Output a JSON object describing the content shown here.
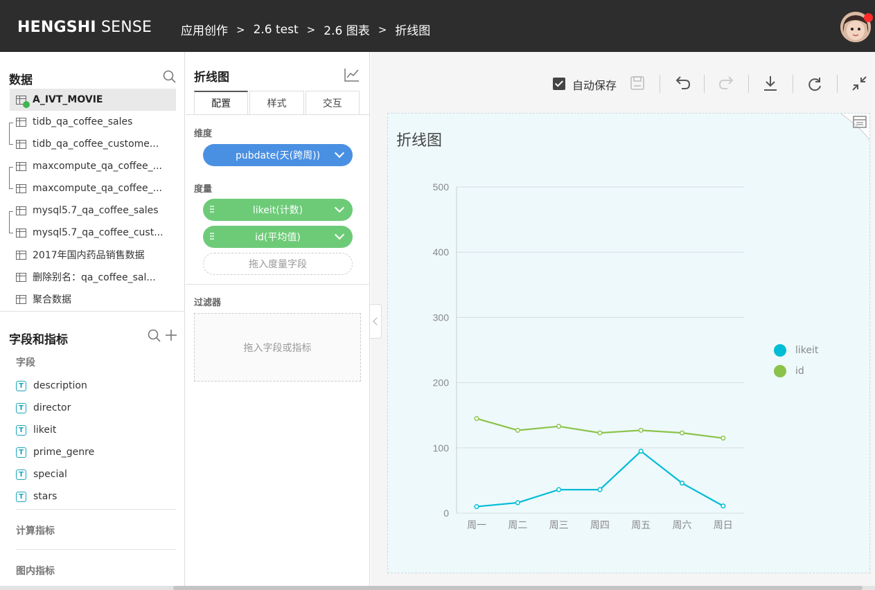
{
  "header": {
    "logo_bold": "HENGSHI",
    "logo_thin": " SENSE",
    "breadcrumbs": [
      "应用创作",
      "2.6 test",
      "2.6 图表",
      "折线图"
    ],
    "separator": ">"
  },
  "data_panel": {
    "title": "数据",
    "datasets": [
      "A_IVT_MOVIE",
      "tidb_qa_coffee_sales",
      "tidb_qa_coffee_custome...",
      "maxcompute_qa_coffee_...",
      "maxcompute_qa_coffee_...",
      "mysql5.7_qa_coffee_sales",
      "mysql5.7_qa_coffee_cust...",
      "2017年国内药品销售数据",
      "删除别名：qa_coffee_sal...",
      "聚合数据"
    ]
  },
  "fields_panel": {
    "title": "字段和指标",
    "fields_label": "字段",
    "fields": [
      "description",
      "director",
      "likeit",
      "prime_genre",
      "special",
      "stars"
    ],
    "calc_label": "计算指标",
    "chart_metric_label": "图内指标",
    "field_type_glyph": "T"
  },
  "config_panel": {
    "title": "折线图",
    "tabs": [
      "配置",
      "样式",
      "交互"
    ],
    "dimension_label": "维度",
    "dimension": "pubdate(天(跨周))",
    "measure_label": "度量",
    "measures": [
      "likeit(计数)",
      "id(平均值)"
    ],
    "measure_drop": "拖入度量字段",
    "filter_label": "过滤器",
    "filter_drop": "拖入字段或指标"
  },
  "toolbar": {
    "autosave_label": "自动保存",
    "autosave_checked": true,
    "icons": [
      "save-icon",
      "undo-icon",
      "redo-icon",
      "download-icon",
      "refresh-icon",
      "collapse-icon"
    ]
  },
  "colors": {
    "likeit": "#00bcd4",
    "id": "#8bc34a",
    "pill_blue": "#4a90e2",
    "pill_green": "#6dcb78"
  },
  "chart_data": {
    "type": "line",
    "title": "折线图",
    "categories": [
      "周一",
      "周二",
      "周三",
      "周四",
      "周五",
      "周六",
      "周日"
    ],
    "series": [
      {
        "name": "likeit",
        "values": [
          10,
          16,
          36,
          36,
          95,
          46,
          11
        ]
      },
      {
        "name": "id",
        "values": [
          145,
          127,
          133,
          123,
          127,
          123,
          115
        ]
      }
    ],
    "yticks": [
      0,
      100,
      200,
      300,
      400,
      500
    ],
    "ylim": [
      0,
      500
    ],
    "grid": true,
    "legend": "right"
  }
}
